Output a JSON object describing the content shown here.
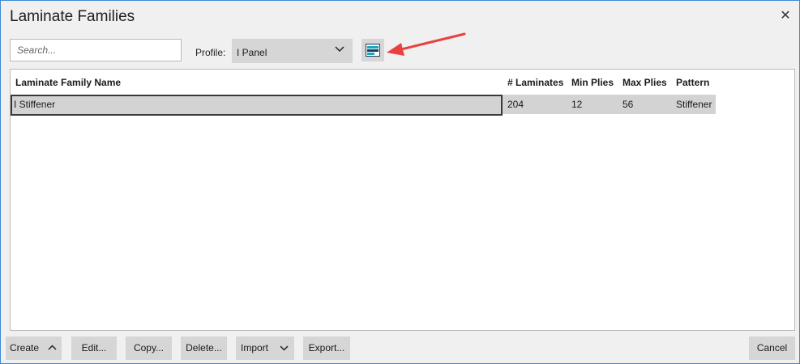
{
  "window": {
    "title": "Laminate Families"
  },
  "toolbar": {
    "search_placeholder": "Search...",
    "profile_label": "Profile:",
    "profile_value": "I Panel"
  },
  "table": {
    "columns": [
      "Laminate Family Name",
      "# Laminates",
      "Min Plies",
      "Max Plies",
      "Pattern"
    ],
    "rows": [
      {
        "name": "I Stiffener",
        "laminates": "204",
        "min_plies": "12",
        "max_plies": "56",
        "pattern": "Stiffener"
      }
    ]
  },
  "buttons": {
    "create": "Create",
    "edit": "Edit...",
    "copy": "Copy...",
    "delete": "Delete...",
    "import": "Import",
    "export": "Export...",
    "cancel": "Cancel"
  },
  "icons": {
    "close": "close-icon",
    "layout": "column-layout-icon",
    "chevron_down": "chevron-down-icon",
    "chevron_up": "chevron-up-icon"
  },
  "colors": {
    "accent": "#3c8ad2",
    "annotation": "#e8423f",
    "layout_icon": "#1ba3c4"
  }
}
